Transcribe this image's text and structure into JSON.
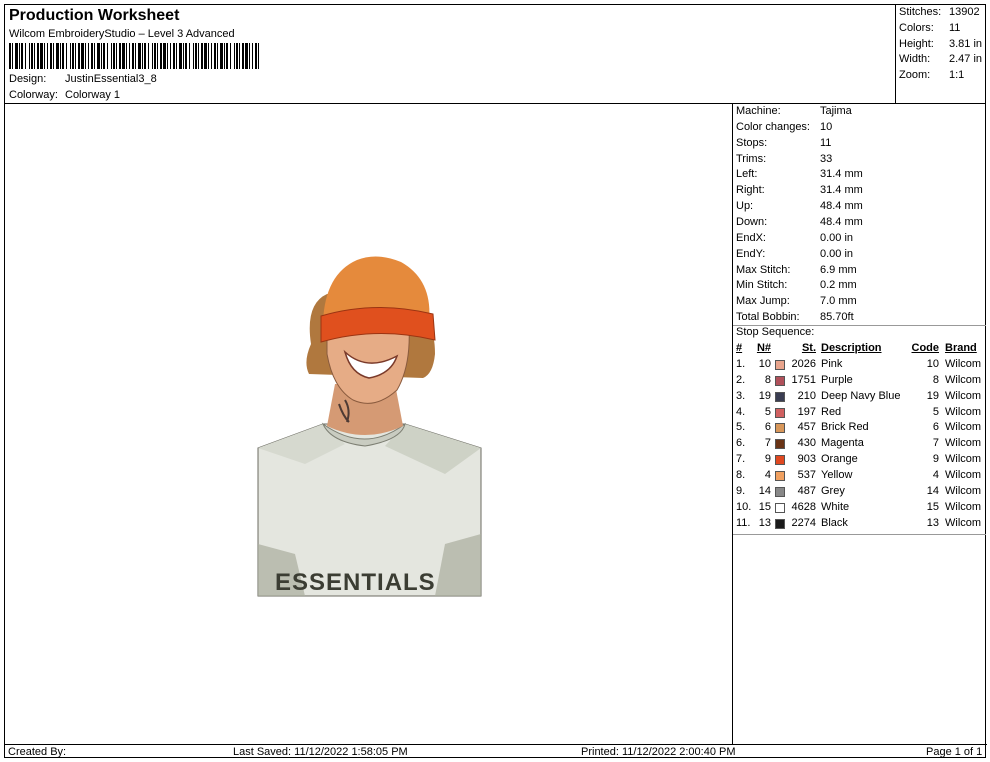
{
  "header": {
    "title": "Production Worksheet",
    "software": "Wilcom EmbroideryStudio – Level 3 Advanced",
    "design_label": "Design:",
    "design_value": "JustinEssential3_8",
    "colorway_label": "Colorway:",
    "colorway_value": "Colorway 1"
  },
  "summary": [
    {
      "label": "Stitches:",
      "value": "13902"
    },
    {
      "label": "Colors:",
      "value": "11"
    },
    {
      "label": "Height:",
      "value": "3.81 in"
    },
    {
      "label": "Width:",
      "value": "2.47 in"
    },
    {
      "label": "Zoom:",
      "value": "1:1"
    }
  ],
  "info": [
    {
      "label": "Machine:",
      "value": "Tajima"
    },
    {
      "label": "Color changes:",
      "value": "10"
    },
    {
      "label": "Stops:",
      "value": "11"
    },
    {
      "label": "Trims:",
      "value": "33"
    },
    {
      "label": "Left:",
      "value": "31.4 mm"
    },
    {
      "label": "Right:",
      "value": "31.4 mm"
    },
    {
      "label": "Up:",
      "value": "48.4 mm"
    },
    {
      "label": "Down:",
      "value": "48.4 mm"
    },
    {
      "label": "EndX:",
      "value": "0.00 in"
    },
    {
      "label": "EndY:",
      "value": "0.00 in"
    },
    {
      "label": "Max Stitch:",
      "value": "6.9 mm"
    },
    {
      "label": "Min Stitch:",
      "value": "0.2 mm"
    },
    {
      "label": "Max Jump:",
      "value": "7.0 mm"
    },
    {
      "label": "Total Bobbin:",
      "value": "85.70ft"
    }
  ],
  "stop_sequence": {
    "title": "Stop Sequence:",
    "columns": {
      "no": "#",
      "n": "N#",
      "st": "St.",
      "desc": "Description",
      "code": "Code",
      "brand": "Brand"
    },
    "rows": [
      {
        "no": "1.",
        "n": "10",
        "color": "#e8a48c",
        "st": "2026",
        "desc": "Pink",
        "code": "10",
        "brand": "Wilcom"
      },
      {
        "no": "2.",
        "n": "8",
        "color": "#b0505a",
        "st": "1751",
        "desc": "Purple",
        "code": "8",
        "brand": "Wilcom"
      },
      {
        "no": "3.",
        "n": "19",
        "color": "#3a3d52",
        "st": "210",
        "desc": "Deep Navy Blue",
        "code": "19",
        "brand": "Wilcom"
      },
      {
        "no": "4.",
        "n": "5",
        "color": "#d06060",
        "st": "197",
        "desc": "Red",
        "code": "5",
        "brand": "Wilcom"
      },
      {
        "no": "5.",
        "n": "6",
        "color": "#d8975a",
        "st": "457",
        "desc": "Brick Red",
        "code": "6",
        "brand": "Wilcom"
      },
      {
        "no": "6.",
        "n": "7",
        "color": "#6a3416",
        "st": "430",
        "desc": "Magenta",
        "code": "7",
        "brand": "Wilcom"
      },
      {
        "no": "7.",
        "n": "9",
        "color": "#e04820",
        "st": "903",
        "desc": "Orange",
        "code": "9",
        "brand": "Wilcom"
      },
      {
        "no": "8.",
        "n": "4",
        "color": "#f0a060",
        "st": "537",
        "desc": "Yellow",
        "code": "4",
        "brand": "Wilcom"
      },
      {
        "no": "9.",
        "n": "14",
        "color": "#888888",
        "st": "487",
        "desc": "Grey",
        "code": "14",
        "brand": "Wilcom"
      },
      {
        "no": "10.",
        "n": "15",
        "color": "#ffffff",
        "st": "4628",
        "desc": "White",
        "code": "15",
        "brand": "Wilcom"
      },
      {
        "no": "11.",
        "n": "13",
        "color": "#1a1a1a",
        "st": "2274",
        "desc": "Black",
        "code": "13",
        "brand": "Wilcom"
      }
    ]
  },
  "design_preview": {
    "shirt_text": "ESSENTIALS"
  },
  "footer": {
    "created_by": "Created By:",
    "last_saved": "Last Saved: 11/12/2022 1:58:05 PM",
    "printed": "Printed: 11/12/2022 2:00:40 PM",
    "page": "Page 1 of 1"
  }
}
